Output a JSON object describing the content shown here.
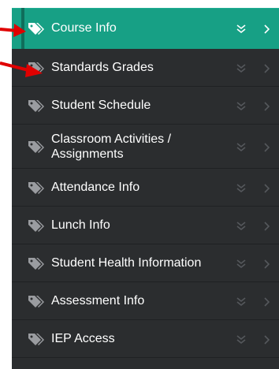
{
  "menu": {
    "items": [
      {
        "label": "Course Info",
        "active": true
      },
      {
        "label": "Standards Grades",
        "active": false
      },
      {
        "label": "Student Schedule",
        "active": false
      },
      {
        "label": "Classroom Activities / Assignments",
        "active": false
      },
      {
        "label": "Attendance Info",
        "active": false
      },
      {
        "label": "Lunch Info",
        "active": false
      },
      {
        "label": "Student Health Information",
        "active": false
      },
      {
        "label": "Assessment Info",
        "active": false
      },
      {
        "label": "IEP Access",
        "active": false
      }
    ]
  },
  "icons": {
    "item": "tags-icon",
    "expand": "double-chevron-down-icon",
    "navigate": "chevron-right-icon",
    "annotation": "red-pointer-arrow-icon"
  },
  "colors": {
    "menu_bg": "#2b2d2f",
    "active_bg": "#17a085",
    "annotation_red": "#e00000"
  }
}
